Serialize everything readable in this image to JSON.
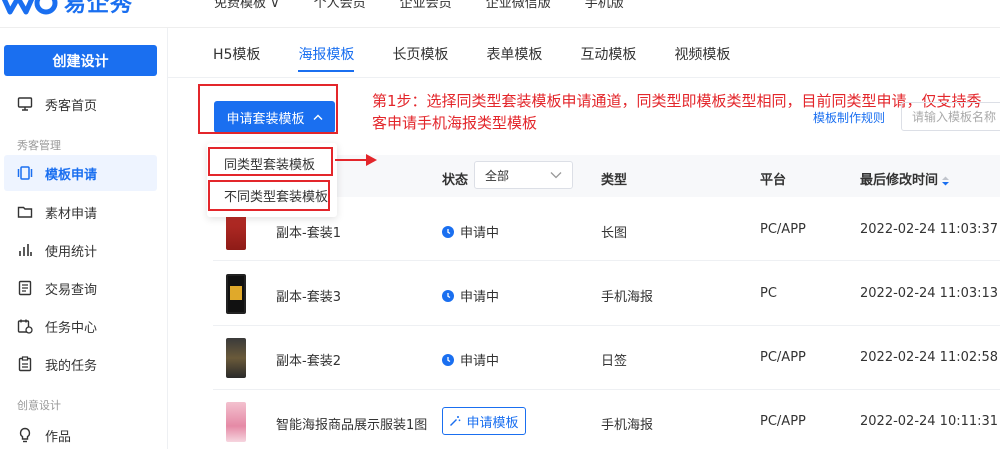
{
  "brand": {
    "name": "易企秀",
    "color": "#1a6ff0"
  },
  "topnav": [
    "免费模板 ∨",
    "个人会员",
    "企业会员",
    "企业微信版",
    "手机版"
  ],
  "sidebar": {
    "create_label": "创建设计",
    "items": [
      {
        "label": "秀客首页",
        "icon": "monitor-icon"
      },
      {
        "label": "模板申请",
        "icon": "template-icon",
        "active": true
      },
      {
        "label": "素材申请",
        "icon": "folder-icon"
      },
      {
        "label": "使用统计",
        "icon": "bar-chart-icon"
      },
      {
        "label": "交易查询",
        "icon": "document-icon"
      },
      {
        "label": "任务中心",
        "icon": "calendar-icon"
      },
      {
        "label": "我的任务",
        "icon": "clipboard-icon"
      },
      {
        "label": "作品",
        "icon": "bulb-icon"
      }
    ],
    "groups": [
      "秀客管理",
      "创意设计"
    ]
  },
  "tabs": [
    "H5模板",
    "海报模板",
    "长页模板",
    "表单模板",
    "互动模板",
    "视频模板"
  ],
  "toolbar": {
    "apply_label": "申请套装模板",
    "dropdown": [
      "同类型套装模板",
      "不同类型套装模板"
    ],
    "rule_link": "模板制作规则",
    "search_placeholder": "请输入模板名称"
  },
  "annotation": "第1步：选择同类型套装模板申请通道，同类型即模板类型相同，目前同类型申请，仅支持秀客申请手机海报类型模板",
  "table": {
    "headers": {
      "status": "状态",
      "status_filter": "全部",
      "type": "类型",
      "platform": "平台",
      "modified": "最后修改时间"
    },
    "rows": [
      {
        "name": "副本-套装1",
        "status": "申请中",
        "type": "长图",
        "platform": "PC/APP",
        "time": "2022-02-24 11:03:37"
      },
      {
        "name": "副本-套装3",
        "status": "申请中",
        "type": "手机海报",
        "platform": "PC",
        "time": "2022-02-24 11:03:13"
      },
      {
        "name": "副本-套装2",
        "status": "申请中",
        "type": "日签",
        "platform": "PC/APP",
        "time": "2022-02-24 11:02:58"
      },
      {
        "name": "智能海报商品展示服装1图",
        "status": "申请模板",
        "type": "手机海报",
        "platform": "PC/APP",
        "time": "2022-02-24 10:11:31"
      }
    ]
  },
  "colors": {
    "primary": "#1a6ff0",
    "annotation_red": "#e3262b",
    "active_bg": "#eef4ff"
  }
}
